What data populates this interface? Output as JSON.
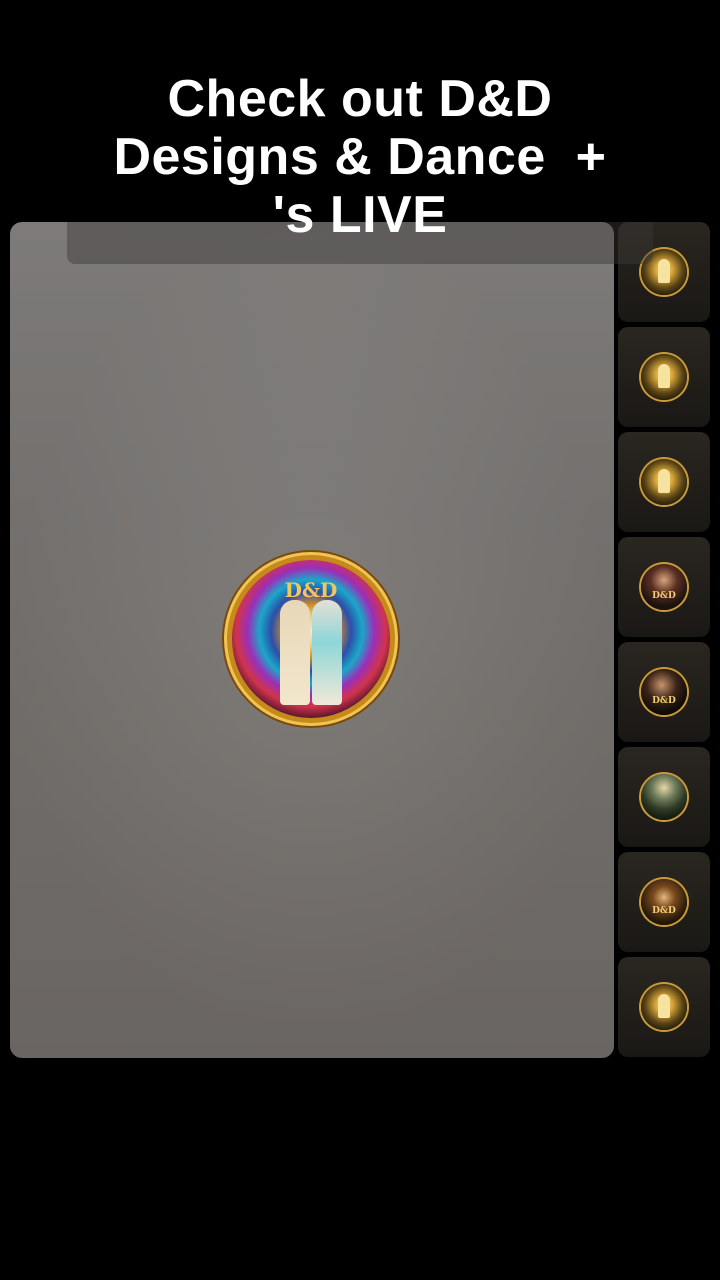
{
  "headline": {
    "line1": "Check out D&D",
    "line2": "Designs & Dance  +",
    "line3": "'s LIVE"
  },
  "host": {
    "avatar_icon": "host-couple-avatar",
    "monogram": "D&D"
  },
  "thumbnails": [
    {
      "icon": "gold-crest-logo",
      "style": "logo",
      "tag": ""
    },
    {
      "icon": "gold-crest-logo",
      "style": "logo",
      "tag": ""
    },
    {
      "icon": "gold-crest-logo",
      "style": "logo",
      "tag": ""
    },
    {
      "icon": "person-avatar",
      "style": "person-a",
      "tag": "D&D"
    },
    {
      "icon": "person-avatar",
      "style": "person-b",
      "tag": "D&D"
    },
    {
      "icon": "person-avatar",
      "style": "person-c",
      "tag": ""
    },
    {
      "icon": "person-avatar",
      "style": "person-d",
      "tag": "D&D"
    },
    {
      "icon": "gold-crest-logo",
      "style": "logo",
      "tag": ""
    }
  ],
  "colors": {
    "background": "#000000",
    "headline_text": "#ffffff",
    "stage": "#7a7775",
    "gold_accent": "#c99a3a"
  }
}
